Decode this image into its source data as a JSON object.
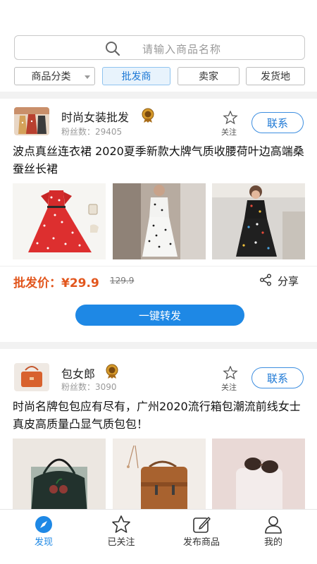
{
  "search": {
    "placeholder": "请输入商品名称"
  },
  "filters": [
    {
      "label": "商品分类",
      "has_dropdown": true
    },
    {
      "label": "批发商",
      "active": true
    },
    {
      "label": "卖家"
    },
    {
      "label": "发货地"
    }
  ],
  "posts": [
    {
      "shop_name": "时尚女装批发",
      "fans_label": "粉丝数：",
      "fans_count": "29405",
      "follow_label": "关注",
      "contact_label": "联系",
      "description": "波点真丝连衣裙 2020夏季新款大牌气质收腰荷叶边高端桑蚕丝长裙",
      "price_label": "批发价：¥29.9",
      "old_price": "129.9",
      "share_label": "分享",
      "forward_label": "一键转发"
    },
    {
      "shop_name": "包女郎",
      "fans_label": "粉丝数：",
      "fans_count": "3090",
      "follow_label": "关注",
      "contact_label": "联系",
      "description": "时尚名牌包包应有尽有，广州2020流行箱包潮流前线女士真皮高质量凸显气质包包！"
    }
  ],
  "tabbar": [
    {
      "label": "发现",
      "icon": "compass-icon",
      "active": true
    },
    {
      "label": "已关注",
      "icon": "star-icon"
    },
    {
      "label": "发布商品",
      "icon": "edit-icon"
    },
    {
      "label": "我的",
      "icon": "user-icon"
    }
  ],
  "colors": {
    "accent": "#1e88e5",
    "price": "#e2561d",
    "badge": "#c98a1c"
  }
}
